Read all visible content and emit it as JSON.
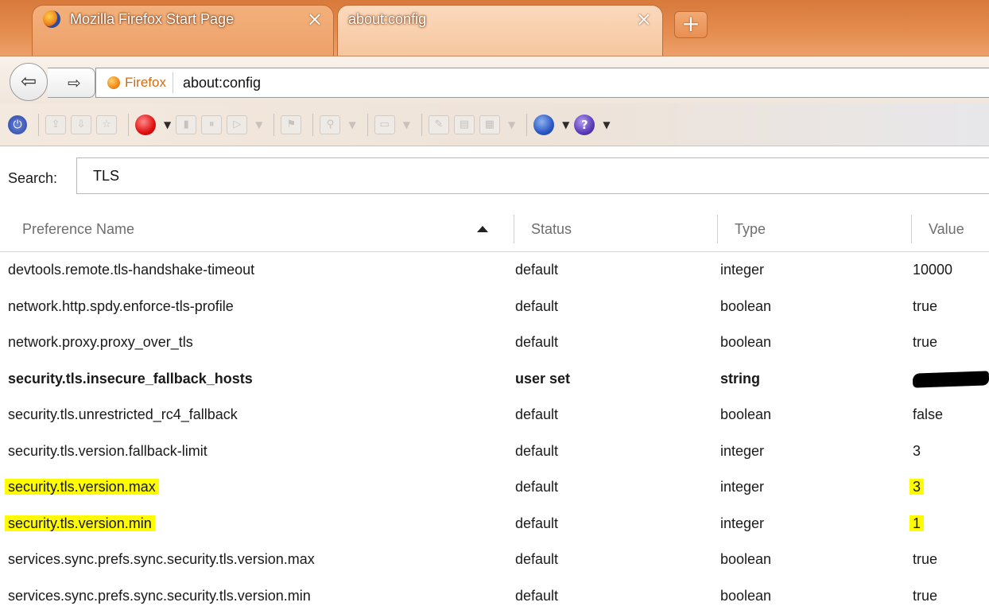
{
  "tabs": [
    {
      "label": "Mozilla Firefox Start Page",
      "active": false
    },
    {
      "label": "about:config",
      "active": true
    }
  ],
  "new_tab_label": "+",
  "nav": {
    "identity": "Firefox",
    "url": "about:config"
  },
  "search": {
    "label": "Search:",
    "value": "TLS"
  },
  "columns": {
    "name": "Preference Name",
    "status": "Status",
    "type": "Type",
    "value": "Value"
  },
  "rows": [
    {
      "name": "devtools.remote.tls-handshake-timeout",
      "status": "default",
      "type": "integer",
      "value": "10000"
    },
    {
      "name": "network.http.spdy.enforce-tls-profile",
      "status": "default",
      "type": "boolean",
      "value": "true"
    },
    {
      "name": "network.proxy.proxy_over_tls",
      "status": "default",
      "type": "boolean",
      "value": "true"
    },
    {
      "name": "security.tls.insecure_fallback_hosts",
      "status": "user set",
      "type": "string",
      "value": ""
    },
    {
      "name": "security.tls.unrestricted_rc4_fallback",
      "status": "default",
      "type": "boolean",
      "value": "false"
    },
    {
      "name": "security.tls.version.fallback-limit",
      "status": "default",
      "type": "integer",
      "value": "3"
    },
    {
      "name": "security.tls.version.max",
      "status": "default",
      "type": "integer",
      "value": "3"
    },
    {
      "name": "security.tls.version.min",
      "status": "default",
      "type": "integer",
      "value": "1"
    },
    {
      "name": "services.sync.prefs.sync.security.tls.version.max",
      "status": "default",
      "type": "boolean",
      "value": "true"
    },
    {
      "name": "services.sync.prefs.sync.security.tls.version.min",
      "status": "default",
      "type": "boolean",
      "value": "true"
    }
  ],
  "colors": {
    "tabstrip": "#e48c4e",
    "highlight": "#fffb00",
    "identity": "#d36b12"
  },
  "icons": [
    "firefox-logo-icon",
    "close-icon",
    "plus-icon",
    "back-arrow-icon",
    "forward-arrow-icon",
    "power-icon",
    "record-icon",
    "globe-icon",
    "help-icon",
    "sort-ascending-icon"
  ]
}
